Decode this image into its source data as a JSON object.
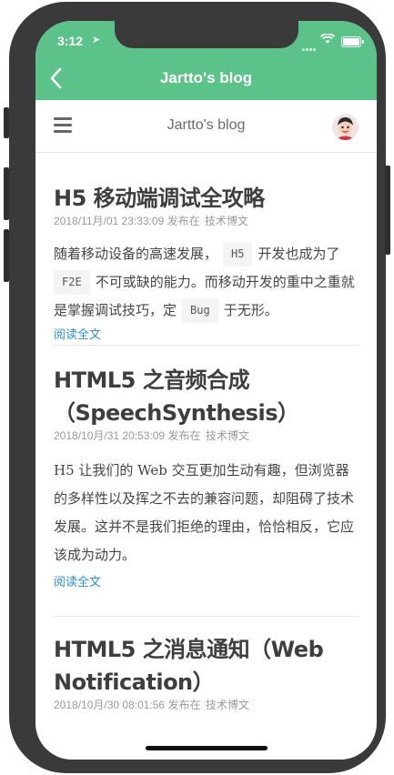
{
  "status": {
    "time": "3:12"
  },
  "nav": {
    "title": "Jartto's blog"
  },
  "site": {
    "title": "Jartto's blog"
  },
  "posts": [
    {
      "title": "H5 移动端调试全攻略",
      "date": "2018/11月/01 23:33:09",
      "posted_in": "发布在",
      "category": "技术博文",
      "excerpt_parts": [
        "随着移动设备的高速发展，",
        "H5",
        "开发也成为了",
        "F2E",
        "不可或缺的能力。而移动开发的重中之重就是掌握调试技巧，定",
        "Bug",
        "于无形。"
      ],
      "read_more": "阅读全文"
    },
    {
      "title_line1": "HTML5 之音频合成",
      "title_line2": "（SpeechSynthesis）",
      "date": "2018/10月/31 20:53:09",
      "posted_in": "发布在",
      "category": "技术博文",
      "excerpt": "H5 让我们的 Web 交互更加生动有趣，但浏览器的多样性以及挥之不去的兼容问题，却阻碍了技术发展。这并不是我们拒绝的理由，恰恰相反，它应该成为动力。",
      "read_more": "阅读全文"
    },
    {
      "title_line1": "HTML5 之消息通知（Web",
      "title_line2": "Notification）",
      "date": "2018/10月/30 08:01:56",
      "posted_in": "发布在",
      "category": "技术博文"
    }
  ],
  "icons": {
    "back": "chevron-left-icon",
    "menu": "hamburger-menu-icon",
    "avatar": "avatar"
  },
  "colors": {
    "header_green": "#5bc38a",
    "link_blue": "#2b90d9"
  }
}
